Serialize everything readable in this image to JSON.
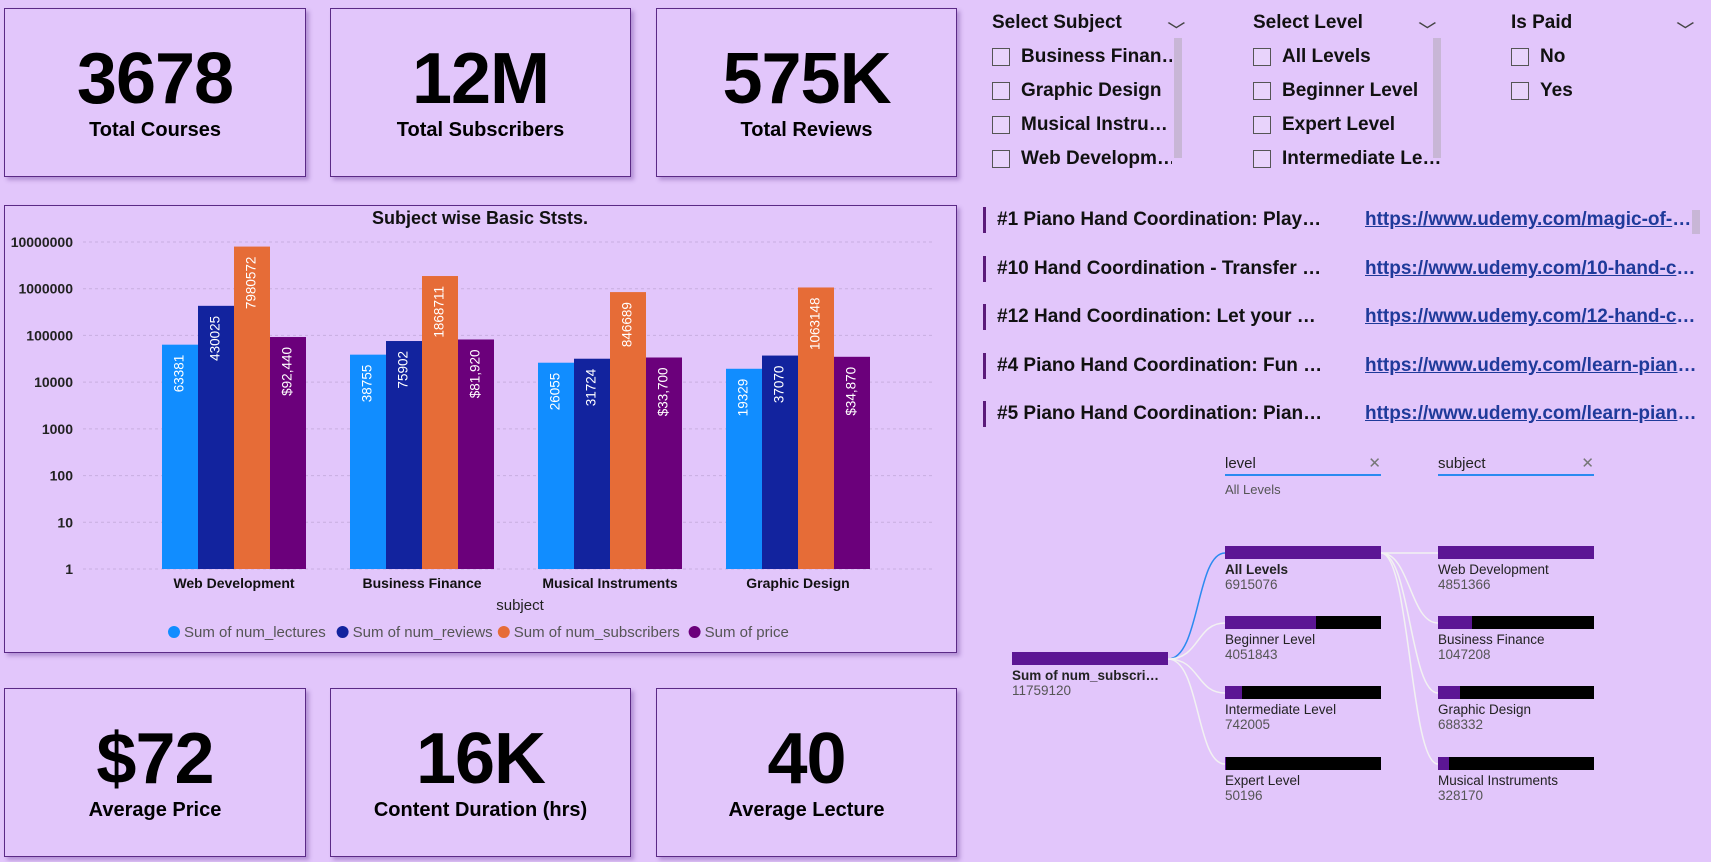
{
  "kpis_top": [
    {
      "value": "3678",
      "label": "Total Courses"
    },
    {
      "value": "12M",
      "label": "Total Subscribers"
    },
    {
      "value": "575K",
      "label": "Total Reviews"
    }
  ],
  "kpis_bottom": [
    {
      "value": "$72",
      "label": "Average Price"
    },
    {
      "value": "16K",
      "label": "Content Duration (hrs)"
    },
    {
      "value": "40",
      "label": "Average Lecture"
    }
  ],
  "slicers": {
    "subject": {
      "title": "Select Subject",
      "options": [
        "Business Finan…",
        "Graphic Design",
        "Musical Instru…",
        "Web Developm…"
      ]
    },
    "level": {
      "title": "Select Level",
      "options": [
        "All Levels",
        "Beginner Level",
        "Expert Level",
        "Intermediate Le…"
      ]
    },
    "paid": {
      "title": "Is Paid",
      "options": [
        "No",
        "Yes"
      ]
    }
  },
  "course_links": [
    {
      "title": "#1 Piano Hand Coordination: Play…",
      "url": "https://www.udemy.com/magic-of-eb…"
    },
    {
      "title": "#10 Hand Coordination - Transfer …",
      "url": "https://www.udemy.com/10-hand-co…"
    },
    {
      "title": "#12 Hand Coordination: Let your …",
      "url": "https://www.udemy.com/12-hand-co…"
    },
    {
      "title": "#4 Piano Hand Coordination: Fun …",
      "url": "https://www.udemy.com/learn-piano-…"
    },
    {
      "title": "#5 Piano Hand Coordination: Pian…",
      "url": "https://www.udemy.com/learn-piano-…"
    }
  ],
  "decomp": {
    "filter_level": {
      "label": "level",
      "value": "All Levels"
    },
    "filter_subject": {
      "label": "subject"
    },
    "root": {
      "label": "Sum of num_subscri…",
      "value": "11759120"
    },
    "levels": [
      {
        "label": "All Levels",
        "value": "6915076",
        "fraction": 1.0
      },
      {
        "label": "Beginner Level",
        "value": "4051843",
        "fraction": 0.586
      },
      {
        "label": "Intermediate Level",
        "value": "742005",
        "fraction": 0.107
      },
      {
        "label": "Expert Level",
        "value": "50196",
        "fraction": 0.007
      }
    ],
    "subjects": [
      {
        "label": "Web Development",
        "value": "4851366",
        "fraction": 1.0
      },
      {
        "label": "Business Finance",
        "value": "1047208",
        "fraction": 0.216
      },
      {
        "label": "Graphic Design",
        "value": "688332",
        "fraction": 0.142
      },
      {
        "label": "Musical Instruments",
        "value": "328170",
        "fraction": 0.068
      }
    ]
  },
  "chart_data": {
    "type": "bar",
    "title": "Subject wise Basic Ststs.",
    "xlabel": "subject",
    "ylabel": "",
    "scale": "log",
    "ylim": [
      1,
      10000000
    ],
    "yticks": [
      "1",
      "10",
      "100",
      "1000",
      "10000",
      "100000",
      "1000000",
      "10000000"
    ],
    "categories": [
      "Web Development",
      "Business Finance",
      "Musical Instruments",
      "Graphic Design"
    ],
    "series": [
      {
        "name": "Sum of num_lectures",
        "color": "#118dff",
        "values": [
          63381,
          38755,
          26055,
          19329
        ],
        "labels": [
          "63381",
          "38755",
          "26055",
          "19329"
        ]
      },
      {
        "name": "Sum of num_reviews",
        "color": "#12239e",
        "values": [
          430025,
          75902,
          31724,
          37070
        ],
        "labels": [
          "430025",
          "75902",
          "31724",
          "37070"
        ]
      },
      {
        "name": "Sum of num_subscribers",
        "color": "#e66c37",
        "values": [
          7980572,
          1868711,
          846689,
          1063148
        ],
        "labels": [
          "7980572",
          "1868711",
          "846689",
          "1063148"
        ]
      },
      {
        "name": "Sum of price",
        "color": "#6b007b",
        "values": [
          92440,
          81920,
          33700,
          34870
        ],
        "labels": [
          "$92,440",
          "$81,920",
          "$33,700",
          "$34,870"
        ]
      }
    ],
    "legend": "bottom",
    "grid": true
  }
}
